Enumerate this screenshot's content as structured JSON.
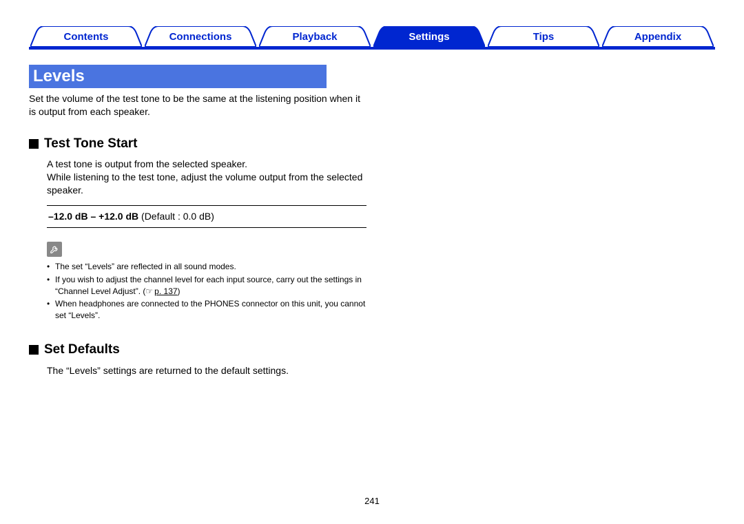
{
  "nav": {
    "tabs": [
      {
        "label": "Contents",
        "active": false
      },
      {
        "label": "Connections",
        "active": false
      },
      {
        "label": "Playback",
        "active": false
      },
      {
        "label": "Settings",
        "active": true
      },
      {
        "label": "Tips",
        "active": false
      },
      {
        "label": "Appendix",
        "active": false
      }
    ]
  },
  "section": {
    "title": "Levels"
  },
  "intro": "Set the volume of the test tone to be the same at the listening position when it is output from each speaker.",
  "sub1": {
    "heading": "Test Tone Start",
    "desc": "A test tone is output from the selected speaker.\nWhile listening to the test tone, adjust the volume output from the selected speaker.",
    "range_bold": "–12.0 dB – +12.0 dB",
    "range_normal": " (Default : 0.0 dB)"
  },
  "notes": {
    "items": [
      "The set “Levels” are reflected in all sound modes.",
      "If you wish to adjust the channel level for each input source, carry out the settings in “Channel Level Adjust”.  (",
      "When headphones are connected to the PHONES connector on this unit, you cannot set “Levels”."
    ],
    "page_ref_icon": "☞",
    "page_ref_text": "p. 137",
    "page_ref_close": ")"
  },
  "sub2": {
    "heading": "Set Defaults",
    "desc": "The “Levels” settings are returned to the default settings."
  },
  "page_number": "241"
}
